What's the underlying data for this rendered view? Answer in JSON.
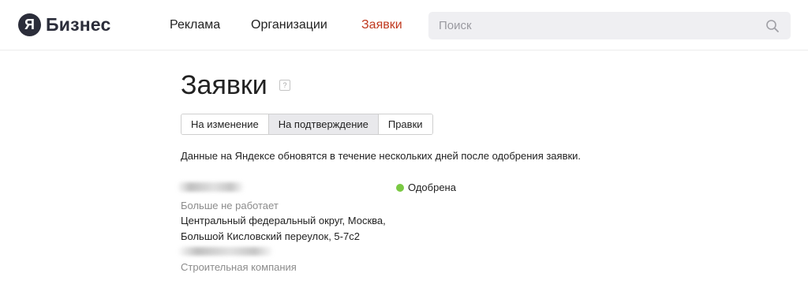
{
  "header": {
    "logo_glyph": "Я",
    "logo_text": "Бизнес",
    "nav": [
      {
        "label": "Реклама",
        "active": false
      },
      {
        "label": "Организации",
        "active": false
      },
      {
        "label": "Заявки",
        "active": true
      }
    ],
    "search": {
      "placeholder": "Поиск",
      "value": "",
      "icon": "search-icon"
    },
    "active_color": "#c0391f"
  },
  "main": {
    "title": "Заявки",
    "help_glyph": "?",
    "tabs": [
      {
        "label": "На изменение",
        "selected": false
      },
      {
        "label": "На подтверждение",
        "selected": true
      },
      {
        "label": "Правки",
        "selected": false
      }
    ],
    "notice": "Данные на Яндексе обновятся в течение нескольких дней после одобрения заявки.",
    "request": {
      "status_label": "Одобрена",
      "status_color": "#7ac943",
      "field_note": "Больше не работает",
      "address_line1": "Центральный федеральный округ, Москва,",
      "address_line2": "Большой Кисловский переулок, 5-7с2",
      "category": "Строительная компания"
    }
  }
}
